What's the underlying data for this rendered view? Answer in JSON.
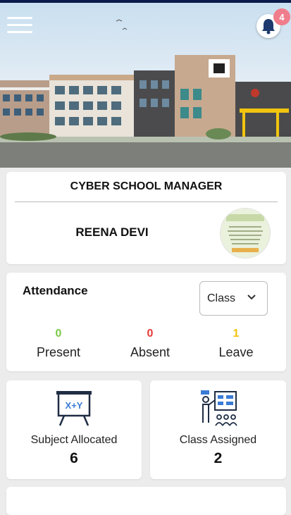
{
  "header": {
    "notification_count": "4"
  },
  "school": {
    "name": "CYBER SCHOOL MANAGER"
  },
  "user": {
    "name": "REENA DEVI"
  },
  "attendance": {
    "title": "Attendance",
    "class_select": {
      "selected": "Class"
    },
    "stats": [
      {
        "label": "Present",
        "value": "0",
        "color": "#7ac943"
      },
      {
        "label": "Absent",
        "value": "0",
        "color": "#e53935"
      },
      {
        "label": "Leave",
        "value": "1",
        "color": "#f4c20d"
      }
    ]
  },
  "tiles": [
    {
      "label": "Subject Allocated",
      "value": "6",
      "icon": "blackboard-icon"
    },
    {
      "label": "Class Assigned",
      "value": "2",
      "icon": "teacher-presentation-icon"
    }
  ]
}
